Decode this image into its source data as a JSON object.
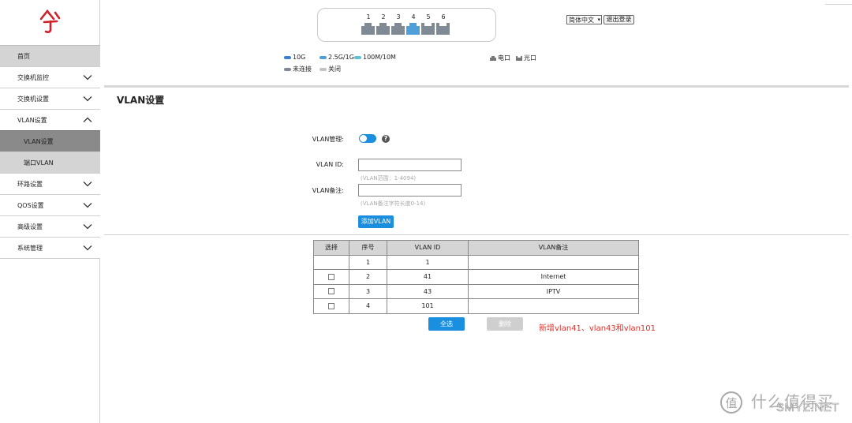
{
  "colors": {
    "accent": "#1a8fe0",
    "port_10g": "#3f7fd0",
    "port_2_5g": "#4f9fd8",
    "port_100m": "#5cc3d6",
    "port_disconnected": "#7f8a94",
    "port_off": "#c3c3c3",
    "note": "#e0302a"
  },
  "sidebar": {
    "logo_icon": "brand-logo-icon",
    "items": [
      {
        "label": "首页"
      },
      {
        "label": "交换机监控",
        "icon": "chevron-down-icon"
      },
      {
        "label": "交换机设置",
        "icon": "chevron-down-icon"
      },
      {
        "label": "VLAN设置",
        "icon": "chevron-up-icon"
      },
      {
        "label": "VLAN设置"
      },
      {
        "label": "端口VLAN"
      },
      {
        "label": "环路设置",
        "icon": "chevron-down-icon"
      },
      {
        "label": "QOS设置",
        "icon": "chevron-down-icon"
      },
      {
        "label": "高级设置",
        "icon": "chevron-down-icon"
      },
      {
        "label": "系统管理",
        "icon": "chevron-down-icon"
      }
    ]
  },
  "ports": [
    {
      "num": "1",
      "state": "disconnected"
    },
    {
      "num": "2",
      "state": "disconnected"
    },
    {
      "num": "3",
      "state": "disconnected"
    },
    {
      "num": "4",
      "state": "connected-2.5g"
    },
    {
      "num": "5",
      "state": "disconnected"
    },
    {
      "num": "6",
      "state": "disconnected"
    }
  ],
  "legend": {
    "speed_10g": "10G",
    "speed_2_5g": "2.5G/1G",
    "speed_100m": "100M/10M",
    "disconnected": "未连接",
    "off": "关闭",
    "electric_port": "电口",
    "optical_port": "光口"
  },
  "header": {
    "language": "简体中文",
    "logout": "退出登录"
  },
  "main": {
    "title": "VLAN设置",
    "form": {
      "vlan_manage_label": "VLAN管理:",
      "vlan_manage_on": true,
      "vlan_id_label": "VLAN ID:",
      "vlan_id_value": "",
      "vlan_id_hint": "(VLAN范围：1-4094)",
      "vlan_note_label": "VLAN备注:",
      "vlan_note_value": "",
      "vlan_note_hint": "(VLAN备注字符长度0-14)",
      "add_button": "添加VLAN"
    },
    "table": {
      "headers": [
        "选择",
        "序号",
        "VLAN ID",
        "VLAN备注"
      ],
      "rows": [
        {
          "checkbox": false,
          "index": "1",
          "vlan_id": "1",
          "note": ""
        },
        {
          "checkbox": true,
          "index": "2",
          "vlan_id": "41",
          "note": "Internet"
        },
        {
          "checkbox": true,
          "index": "3",
          "vlan_id": "43",
          "note": "IPTV"
        },
        {
          "checkbox": true,
          "index": "4",
          "vlan_id": "101",
          "note": ""
        }
      ]
    },
    "select_all_button": "全选",
    "delete_button": "删除",
    "annotation": "新增vlan41、vlan43和vlan101"
  },
  "watermark": {
    "chinese": "什么值得买",
    "english": "SMYZ.NET"
  }
}
